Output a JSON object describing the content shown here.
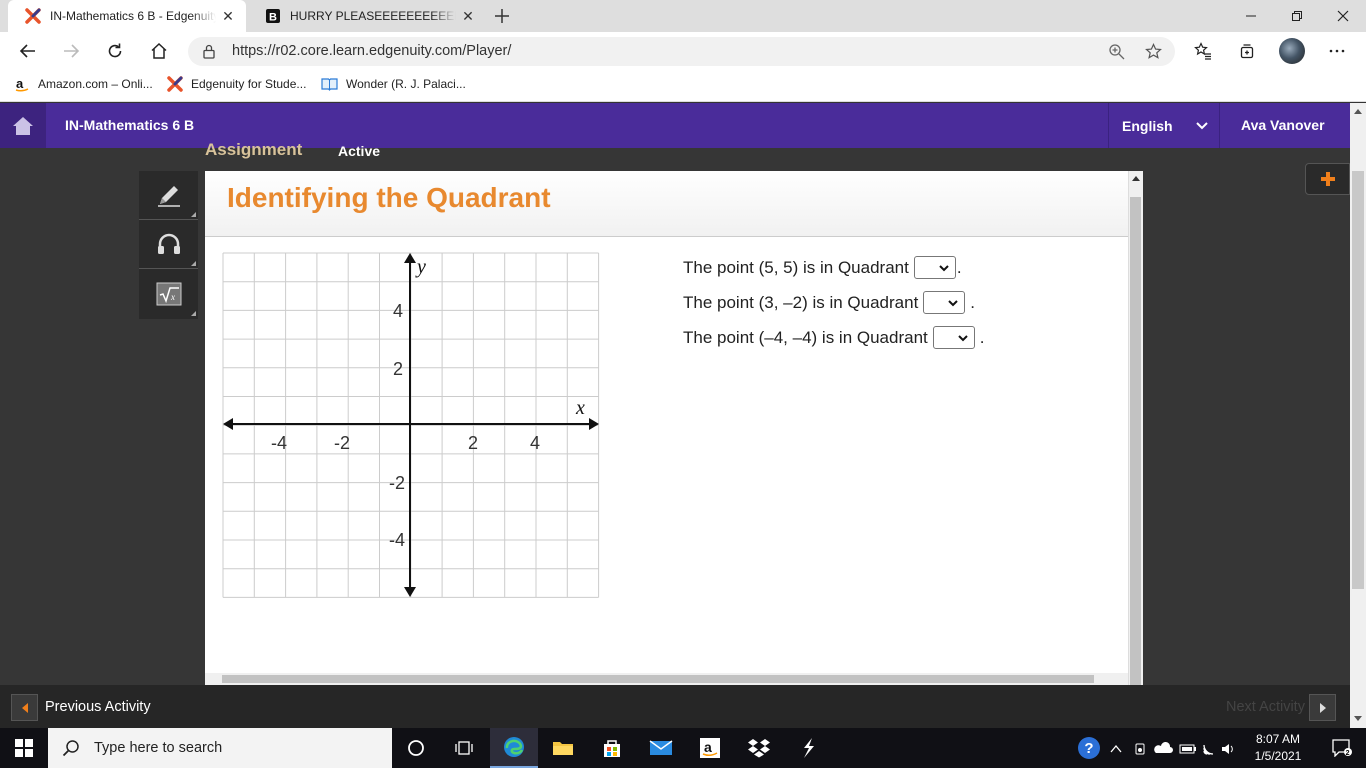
{
  "browser": {
    "tabs": [
      {
        "title": "IN-Mathematics 6 B - Edgenuity",
        "active": true
      },
      {
        "title": "HURRY PLEASEEEEEEEEEEE. A co",
        "active": false
      }
    ],
    "url": "https://r02.core.learn.edgenuity.com/Player/",
    "bookmarks": [
      "Amazon.com – Onli...",
      "Edgenuity for Stude...",
      "Wonder (R. J. Palaci..."
    ]
  },
  "app": {
    "course_title": "IN-Mathematics 6 B",
    "language": "English",
    "user": "Ava Vanover",
    "assignment_label": "Assignment",
    "status": "Active"
  },
  "lesson": {
    "title": "Identifying the Quadrant",
    "questions": [
      {
        "prefix": "The point (5, 5) is in Quadrant",
        "suffix": "."
      },
      {
        "prefix": "The point (3, –2) is in Quadrant",
        "suffix": "."
      },
      {
        "prefix": "The point (–4, –4) is in Quadrant",
        "suffix": "."
      }
    ]
  },
  "graph": {
    "x_label": "x",
    "y_label": "y",
    "x_ticks": [
      "-4",
      "-2",
      "2",
      "4"
    ],
    "y_ticks": [
      "4",
      "2",
      "-2",
      "-4"
    ]
  },
  "footer": {
    "previous": "Previous Activity",
    "next": "Next Activity"
  },
  "taskbar": {
    "search_placeholder": "Type here to search",
    "time": "8:07 AM",
    "date": "1/5/2021"
  },
  "colors": {
    "header": "#4a2c9a",
    "lesson_title": "#e8892f",
    "plus": "#f07f1b"
  }
}
